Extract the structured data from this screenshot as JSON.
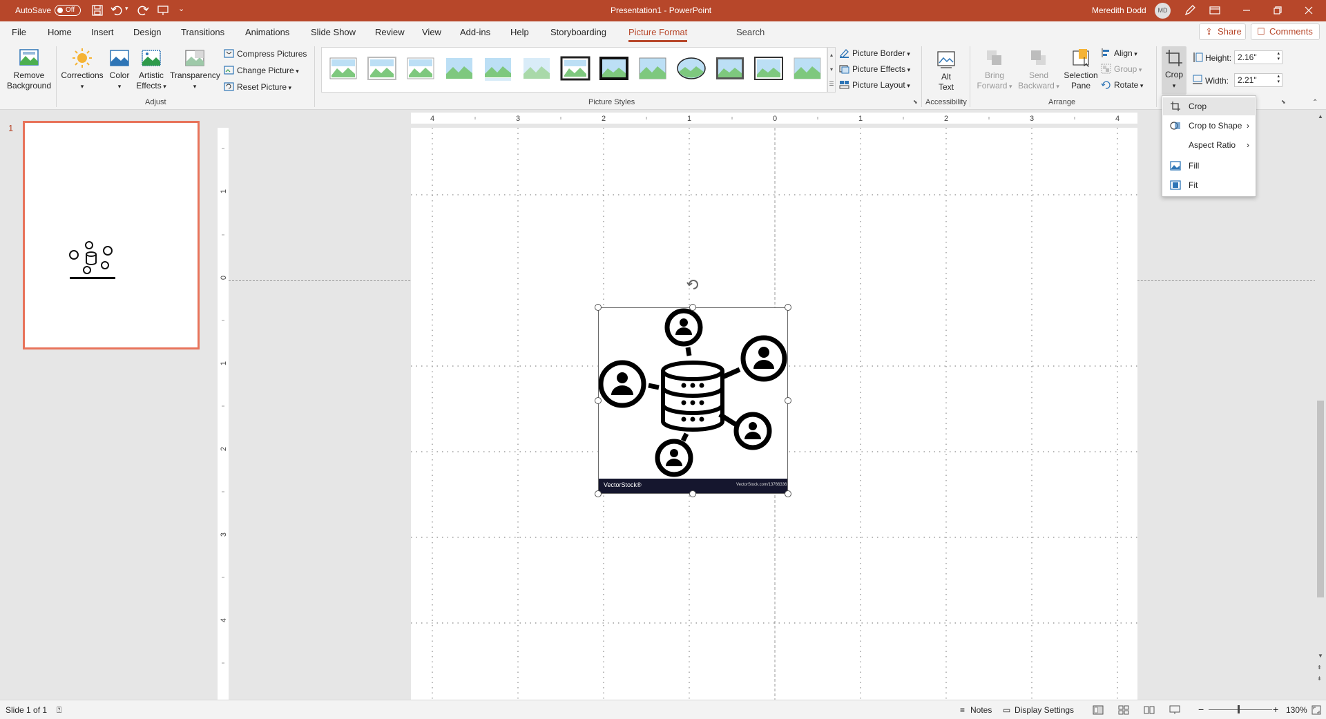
{
  "titlebar": {
    "autosave_label": "AutoSave",
    "autosave_state": "Off",
    "document_title": "Presentation1  -  PowerPoint",
    "user_name": "Meredith Dodd",
    "user_initials": "MD"
  },
  "tabs": [
    "File",
    "Home",
    "Insert",
    "Design",
    "Transitions",
    "Animations",
    "Slide Show",
    "Review",
    "View",
    "Add-ins",
    "Help",
    "Storyboarding",
    "Picture Format"
  ],
  "active_tab": "Picture Format",
  "search_label": "Search",
  "share_label": "Share",
  "comments_label": "Comments",
  "ribbon": {
    "remove_background": [
      "Remove",
      "Background"
    ],
    "corrections": "Corrections",
    "color": "Color",
    "artistic_effects": [
      "Artistic",
      "Effects"
    ],
    "transparency": "Transparency",
    "compress_pictures": "Compress Pictures",
    "change_picture": "Change Picture",
    "reset_picture": "Reset Picture",
    "adjust_group": "Adjust",
    "picture_styles_group": "Picture Styles",
    "picture_border": "Picture Border",
    "picture_effects": "Picture Effects",
    "picture_layout": "Picture Layout",
    "alt_text": [
      "Alt",
      "Text"
    ],
    "accessibility_group": "Accessibility",
    "bring_forward": [
      "Bring",
      "Forward"
    ],
    "send_backward": [
      "Send",
      "Backward"
    ],
    "selection_pane": [
      "Selection",
      "Pane"
    ],
    "align": "Align",
    "group": "Group",
    "rotate": "Rotate",
    "arrange_group": "Arrange",
    "crop": "Crop",
    "height_label": "Height:",
    "height_value": "2.16\"",
    "width_label": "Width:",
    "width_value": "2.21\""
  },
  "crop_menu": {
    "items": [
      {
        "label": "Crop",
        "icon": "crop-icon",
        "submenu": false,
        "highlighted": true
      },
      {
        "label": "Crop to Shape",
        "icon": "crop-to-shape-icon",
        "submenu": true,
        "highlighted": false
      },
      {
        "label": "Aspect Ratio",
        "icon": "",
        "submenu": true,
        "highlighted": false
      },
      {
        "label": "Fill",
        "icon": "fill-icon",
        "submenu": false,
        "highlighted": false
      },
      {
        "label": "Fit",
        "icon": "fit-icon",
        "submenu": false,
        "highlighted": false
      }
    ]
  },
  "slide_pane": {
    "slide_number": "1"
  },
  "picture": {
    "watermark_left": "VectorStock®",
    "watermark_right": "VectorStock.com/13766336"
  },
  "rulers": {
    "horizontal": [
      "4",
      "3",
      "2",
      "1",
      "0",
      "1",
      "2",
      "3",
      "4"
    ],
    "vertical": [
      "1",
      "0",
      "1",
      "2",
      "3",
      "4"
    ]
  },
  "statusbar": {
    "slide_info": "Slide 1 of 1",
    "notes": "Notes",
    "display_settings": "Display Settings",
    "zoom": "130%"
  },
  "colors": {
    "accent": "#b7472a",
    "thumb_border": "#e8735a"
  }
}
